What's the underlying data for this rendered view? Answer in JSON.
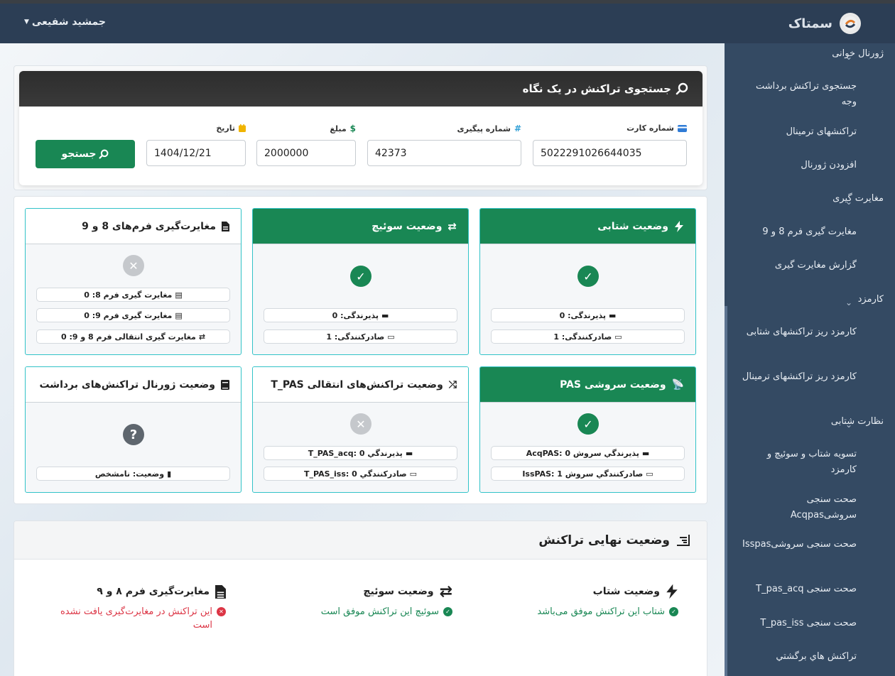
{
  "header": {
    "brand": "سمتاک",
    "user": "جمشید شفیعی"
  },
  "sidebar": {
    "items": [
      {
        "label": "ژورنال خوانی",
        "kind": "head"
      },
      {
        "label": "جستجوی تراکنش برداشت وجه",
        "kind": "sub"
      },
      {
        "label": "تراکنشهای ترمینال",
        "kind": "sub"
      },
      {
        "label": "افزودن ژورنال",
        "kind": "sub"
      },
      {
        "label": "مغایرت گیری",
        "kind": "head"
      },
      {
        "label": "مغایرت گیری فرم 8 و 9",
        "kind": "sub"
      },
      {
        "label": "گزارش مغایرت گیری",
        "kind": "sub"
      },
      {
        "label": "کارمزد",
        "kind": "head"
      },
      {
        "label": "کارمزد ریز تراکنشهای شتابی",
        "kind": "sub"
      },
      {
        "label": "کارمزد ریز تراکنشهای ترمینال",
        "kind": "sub"
      },
      {
        "label": "نظارت شتابی",
        "kind": "head"
      },
      {
        "label": "تسویه شتاب و سوئیچ و کارمزد",
        "kind": "sub"
      },
      {
        "label": "صحت سنجی سروشیAcqpas",
        "kind": "sub"
      },
      {
        "label": "صحت سنجی سروشیIsspas",
        "kind": "sub"
      },
      {
        "label": "صحت سنجی T_pas_acq",
        "kind": "sub"
      },
      {
        "label": "صحت سنجی T_pas_iss",
        "kind": "sub"
      },
      {
        "label": "تراکنش هاي برگشتي",
        "kind": "sub"
      }
    ]
  },
  "search": {
    "title": "جستجوی تراکنش در یک نگاه",
    "card_label": "شماره کارت",
    "card_value": "5022291026644035",
    "tracking_label": "شماره پیگیری",
    "tracking_value": "42373",
    "amount_label": "مبلغ",
    "amount_value": "2000000",
    "date_label": "تاریخ",
    "date_value": "1404/12/21",
    "button": "جستجو"
  },
  "cards": {
    "shetab": {
      "title": "وضعیت شتابی",
      "line1": "پذیرندگی: 0",
      "line2": "صادرکنندگی: 1"
    },
    "switch": {
      "title": "وضعیت سوئیچ",
      "line1": "پذیرندگی: 0",
      "line2": "صادرکنندگی: 1"
    },
    "form89": {
      "title": "مغایرت‌گیری فرم‌های 8 و 9",
      "line1": "مغایرت گیری فرم 8: 0",
      "line2": "مغایرت گیری فرم 9: 0",
      "line3": "مغایرت گیری انتقالی فرم 8 و 9: 0"
    },
    "pas": {
      "title": "وضعیت سروشی PAS",
      "line1": "پذیرندگي سروش AcqPAS: 0",
      "line2": "صادرکنندگي سروش IssPAS: 1"
    },
    "tpas": {
      "title": "وضعیت تراکنش‌های انتقالی T_PAS",
      "line1": "پذیرندگي T_PAS_acq: 0",
      "line2": "صادرکنندگي T_PAS_iss: 0"
    },
    "journal": {
      "title": "وضعیت ژورنال تراکنش‌های برداشت",
      "line1": "وضعیت: نامشخص"
    }
  },
  "final": {
    "title": "وضعیت نهایی تراکنش",
    "shetab_title": "وضعیت شتاب",
    "shetab_msg": "شتاب این تراکنش موفق می‌باشد",
    "switch_title": "وضعیت سوئیچ",
    "switch_msg": "سوئیچ این تراکنش موفق است",
    "form_title": "مغایرت‌گیری فرم ۸ و ۹",
    "form_msg": "این تراکنش در مغایرت‌گیری یافت نشده است"
  },
  "colors": {
    "topbar": "#2c3e55",
    "sidebar": "#344a63",
    "success": "#198754",
    "danger": "#dc3545",
    "accent": "#32c3c8"
  }
}
